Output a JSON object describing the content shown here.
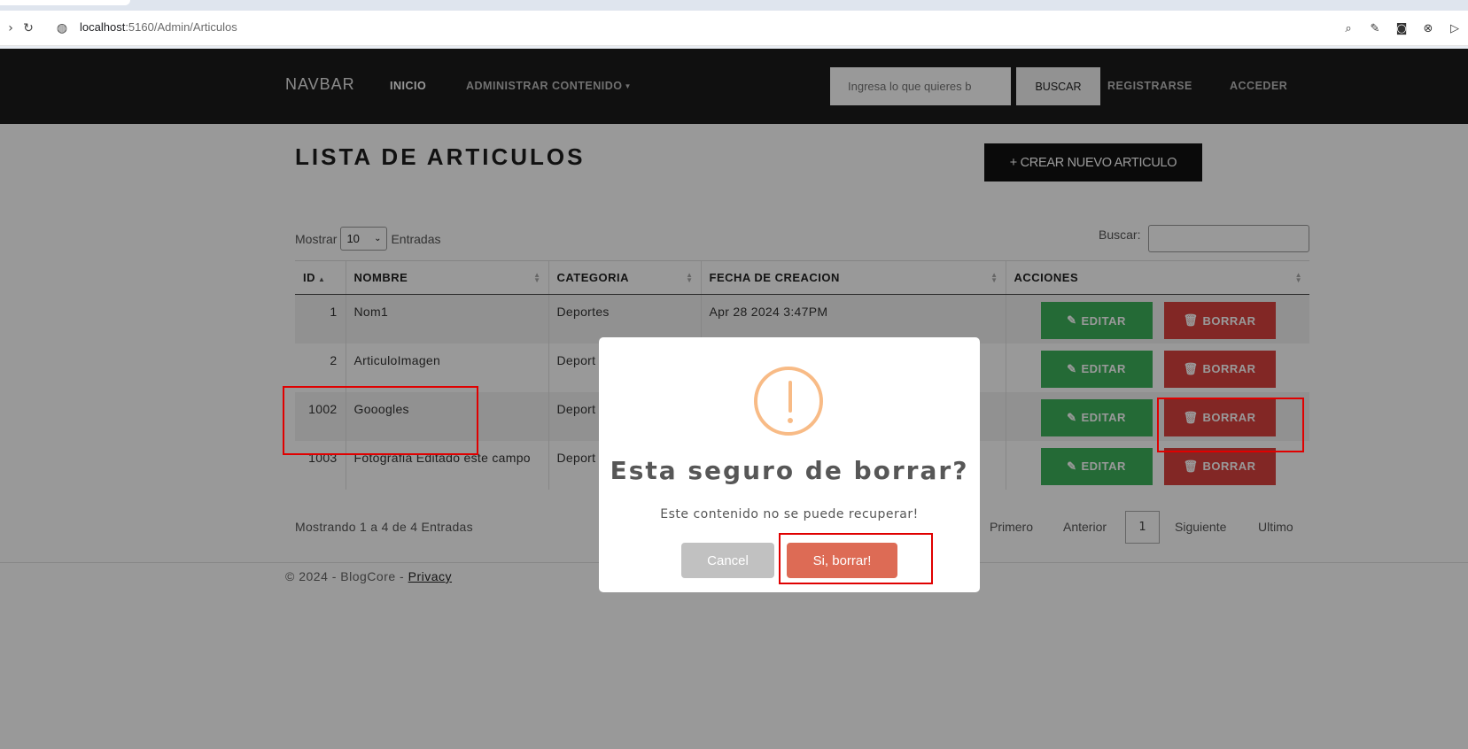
{
  "browser": {
    "url_host": "localhost",
    "url_rest": ":5160/Admin/Articulos"
  },
  "navbar": {
    "brand": "NAVBAR",
    "links": [
      "INICIO",
      "ADMINISTRAR CONTENIDO"
    ],
    "search_placeholder": "Ingresa lo que quieres b",
    "search_button": "BUSCAR",
    "register": "REGISTRARSE",
    "login": "ACCEDER"
  },
  "page": {
    "title": "LISTA DE ARTICULOS",
    "create_button": "+ CREAR NUEVO ARTICULO"
  },
  "table_controls": {
    "show_label": "Mostrar",
    "show_value": "10",
    "entries_label": "Entradas",
    "search_label": "Buscar:"
  },
  "table": {
    "headers": [
      "ID",
      "NOMBRE",
      "CATEGORIA",
      "FECHA DE CREACION",
      "ACCIONES"
    ],
    "rows": [
      {
        "id": "1",
        "nombre": "Nom1",
        "categoria": "Deportes",
        "fecha": "Apr 28 2024 3:47PM"
      },
      {
        "id": "2",
        "nombre": "ArticuloImagen",
        "categoria": "Deport",
        "fecha": ""
      },
      {
        "id": "1002",
        "nombre": "Gooogles",
        "categoria": "Deport",
        "fecha": ""
      },
      {
        "id": "1003",
        "nombre": "Fotografia Editado este campo",
        "categoria": "Deport",
        "fecha": ""
      }
    ],
    "edit_label": "EDITAR",
    "delete_label": "BORRAR"
  },
  "pagination": {
    "info": "Mostrando 1 a 4 de 4 Entradas",
    "first": "Primero",
    "prev": "Anterior",
    "current": "1",
    "next": "Siguiente",
    "last": "Ultimo"
  },
  "footer": {
    "text": "© 2024 - BlogCore -",
    "link": "Privacy"
  },
  "modal": {
    "title": "Esta seguro de borrar?",
    "text": "Este contenido no se puede recuperar!",
    "cancel": "Cancel",
    "confirm": "Si, borrar!",
    "icon": "warning-icon"
  },
  "colors": {
    "edit": "#3cb15b",
    "delete": "#d9413e",
    "confirm": "#dd6b55",
    "warning": "#f8bb86",
    "highlight": "#e00000"
  }
}
